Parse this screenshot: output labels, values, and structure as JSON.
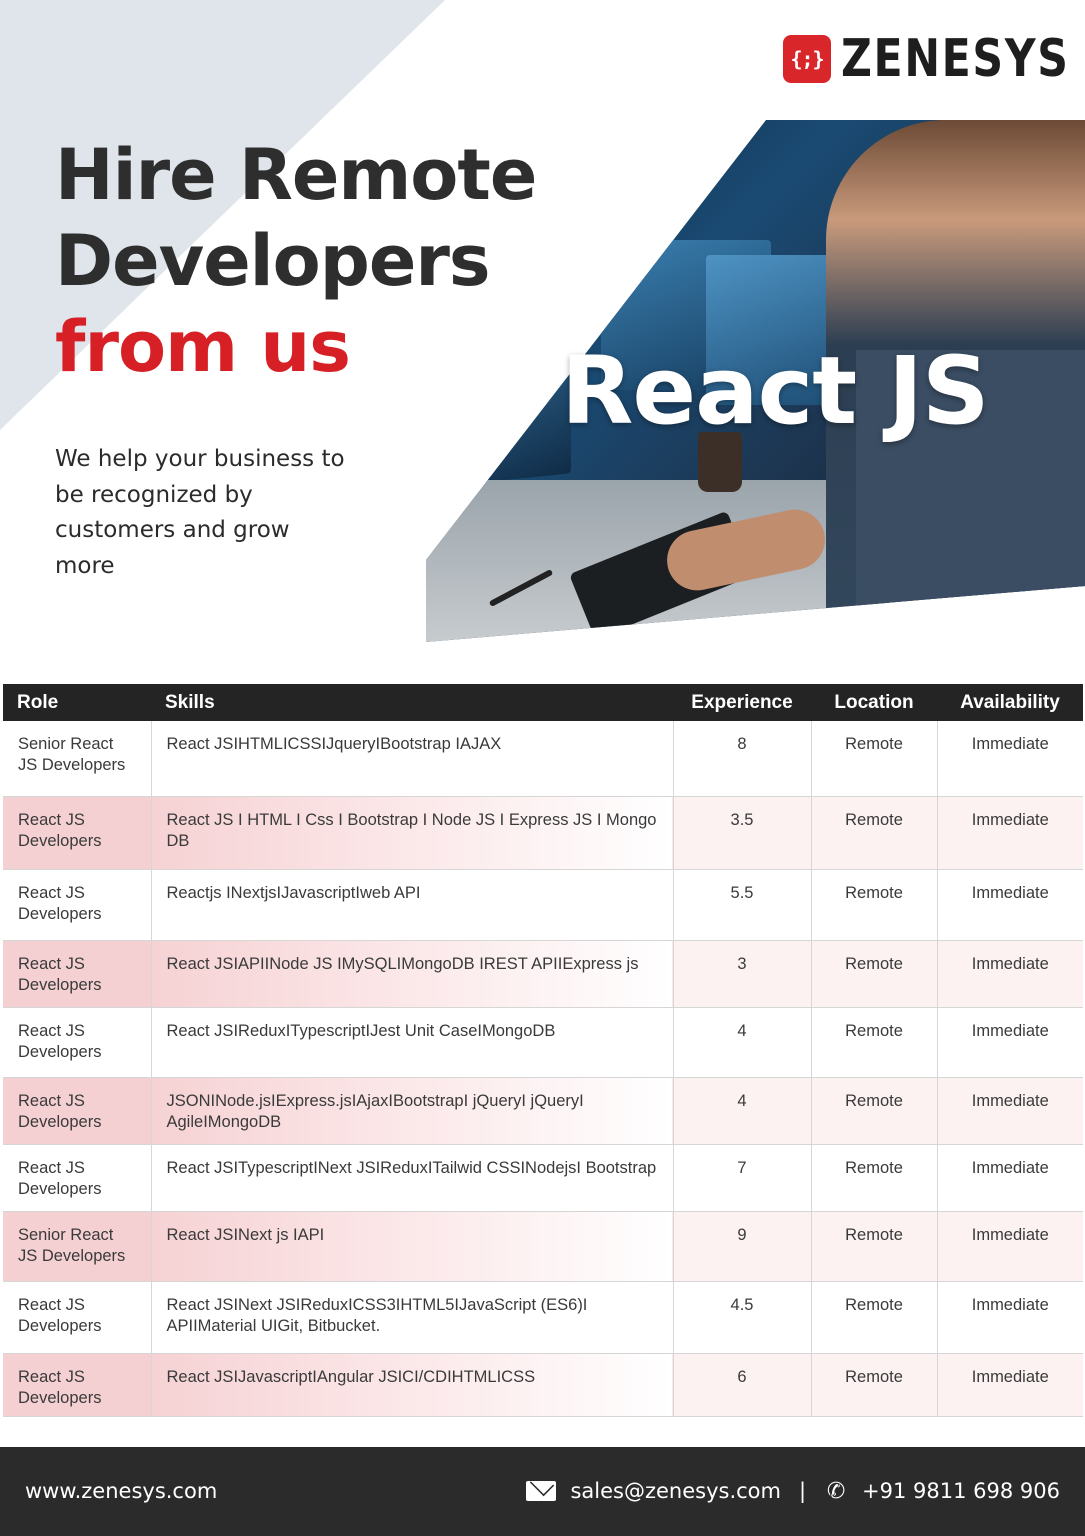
{
  "brand": {
    "logo_mark": "{;}",
    "logo_text": "ZENESYS"
  },
  "headline": {
    "line1": "Hire Remote",
    "line2": "Developers",
    "line3": "from us"
  },
  "tagline": "We help your business to be recognized by customers and grow more",
  "hero": {
    "overlay_text": "React JS"
  },
  "table": {
    "headers": [
      "Role",
      "Skills",
      "Experience",
      "Location",
      "Availability"
    ],
    "rows": [
      {
        "role": "Senior React JS Developers",
        "skills": "React JSIHTMLICSSIJqueryIBootstrap IAJAX",
        "experience": "8",
        "location": "Remote",
        "availability": "Immediate"
      },
      {
        "role": "React JS Developers",
        "skills": "React JS I HTML I Css I Bootstrap I Node JS I Express JS I Mongo DB",
        "experience": "3.5",
        "location": "Remote",
        "availability": "Immediate"
      },
      {
        "role": "React JS Developers",
        "skills": "Reactjs INextjsIJavascriptIweb API",
        "experience": "5.5",
        "location": "Remote",
        "availability": "Immediate"
      },
      {
        "role": "React JS Developers",
        "skills": "React JSIAPIINode JS IMySQLIMongoDB IREST APIIExpress js",
        "experience": "3",
        "location": "Remote",
        "availability": "Immediate"
      },
      {
        "role": "React JS Developers",
        "skills": "React JSIReduxITypescriptIJest Unit CaseIMongoDB",
        "experience": "4",
        "location": "Remote",
        "availability": "Immediate"
      },
      {
        "role": "React JS Developers",
        "skills": "JSONINode.jsIExpress.jsIAjaxIBootstrapI jQueryI jQueryI AgileIMongoDB",
        "experience": "4",
        "location": "Remote",
        "availability": "Immediate"
      },
      {
        "role": "React JS Developers",
        "skills": "React JSITypescriptINext JSIReduxITailwid CSSINodejsI Bootstrap",
        "experience": "7",
        "location": "Remote",
        "availability": "Immediate"
      },
      {
        "role": "Senior React JS Developers",
        "skills": "React JSINext js IAPI",
        "experience": "9",
        "location": "Remote",
        "availability": "Immediate"
      },
      {
        "role": "React JS Developers",
        "skills": "React JSINext JSIReduxICSS3IHTML5IJavaScript (ES6)I APIIMaterial UIGit, Bitbucket.",
        "experience": "4.5",
        "location": "Remote",
        "availability": "Immediate"
      },
      {
        "role": "React JS Developers",
        "skills": "React JSIJavascriptIAngular JSICI/CDIHTMLICSS",
        "experience": "6",
        "location": "Remote",
        "availability": "Immediate"
      }
    ]
  },
  "footer": {
    "website": "www.zenesys.com",
    "email": "sales@zenesys.com",
    "separator": "|",
    "phone": "+91 9811 698 906"
  },
  "colors": {
    "accent_red": "#d71f26",
    "header_dark": "#242424",
    "footer_dark": "#2b2b2b"
  },
  "icons": [
    "mail-icon",
    "phone-icon"
  ]
}
